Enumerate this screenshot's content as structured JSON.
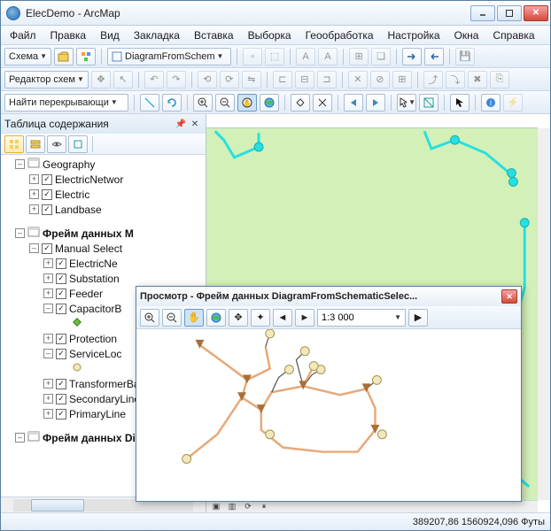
{
  "title": "ElecDemo - ArcMap",
  "menu": [
    "Файл",
    "Правка",
    "Вид",
    "Закладка",
    "Вставка",
    "Выборка",
    "Геообработка",
    "Настройка",
    "Окна",
    "Справка"
  ],
  "toolbar_schema": {
    "label": "Схема",
    "combo": "DiagramFromSchem"
  },
  "toolbar_editor": {
    "label": "Редактор схем"
  },
  "toolbar_find": {
    "label": "Найти перекрывающи"
  },
  "toc": {
    "title": "Таблица содержания"
  },
  "tree": {
    "geo": "Geography",
    "geo_children": [
      "ElectricNetwor",
      "Electric",
      "Landbase"
    ],
    "frame_manual": "Фрейм данных M",
    "manual_sel": "Manual Select",
    "manual_children": [
      "ElectricNe",
      "Substation",
      "Feeder",
      "CapacitorB",
      "Protection",
      "ServiceLoc",
      "TransformerBank",
      "SecondaryLine",
      "PrimaryLine"
    ],
    "frame_diag": "Фрейм данных DiagramFro"
  },
  "viewer": {
    "title": "Просмотр - Фрейм данных DiagramFromSchematicSelec...",
    "scale": "1:3 000"
  },
  "status": {
    "coords": "389207,86 1560924,096 Футы"
  }
}
